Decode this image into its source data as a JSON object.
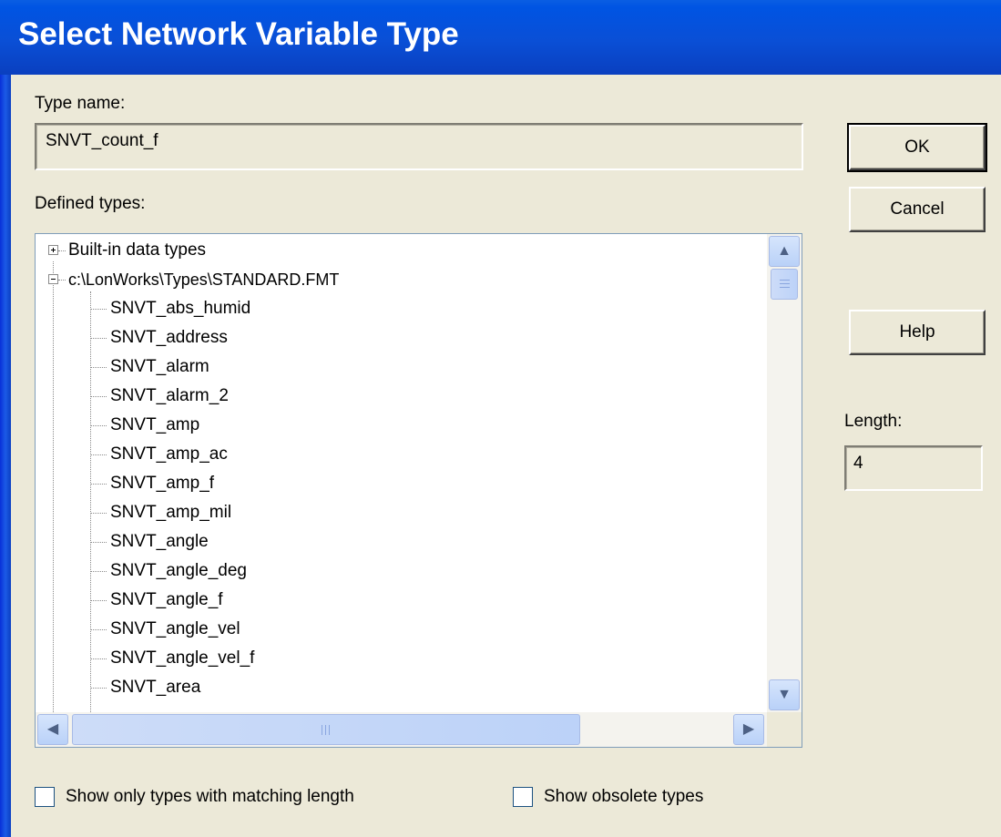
{
  "window": {
    "title": "Select Network Variable Type"
  },
  "type_name": {
    "label": "Type name:",
    "value": "SNVT_count_f"
  },
  "defined_types": {
    "label": "Defined types:",
    "root_items": [
      {
        "label": "Built-in data types",
        "expanded": false
      },
      {
        "label": "c:\\LonWorks\\Types\\STANDARD.FMT",
        "expanded": true
      }
    ],
    "children": [
      "SNVT_abs_humid",
      "SNVT_address",
      "SNVT_alarm",
      "SNVT_alarm_2",
      "SNVT_amp",
      "SNVT_amp_ac",
      "SNVT_amp_f",
      "SNVT_amp_mil",
      "SNVT_angle",
      "SNVT_angle_deg",
      "SNVT_angle_f",
      "SNVT_angle_vel",
      "SNVT_angle_vel_f",
      "SNVT_area"
    ]
  },
  "buttons": {
    "ok": "OK",
    "cancel": "Cancel",
    "help": "Help"
  },
  "length": {
    "label": "Length:",
    "value": "4"
  },
  "options": {
    "matching_length": {
      "label": "Show only types with matching length",
      "checked": false
    },
    "obsolete": {
      "label": "Show obsolete types",
      "checked": false
    }
  },
  "icons": {
    "scroll_up": "▲",
    "scroll_down": "▼",
    "scroll_left": "◀",
    "scroll_right": "▶"
  }
}
